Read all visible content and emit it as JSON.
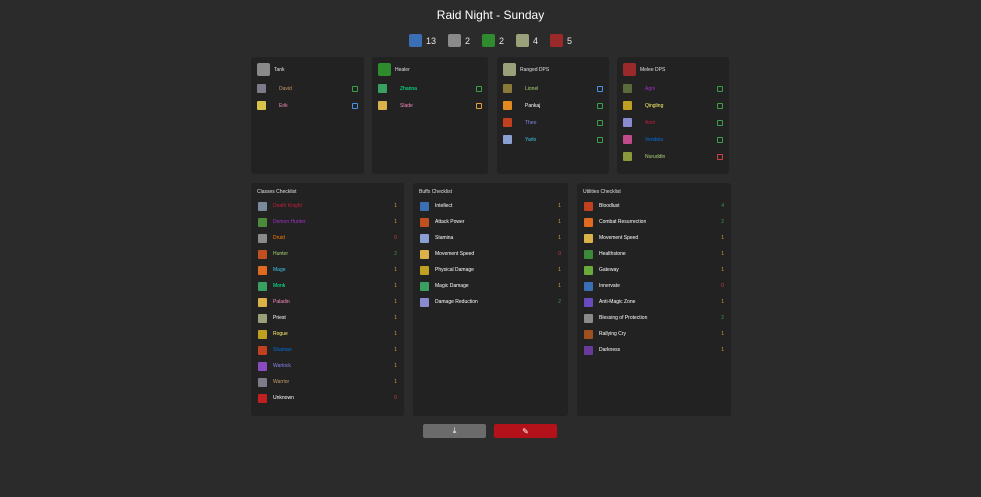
{
  "title": "Raid Night - Sunday",
  "summary": [
    {
      "role": "all",
      "count": "13",
      "icon": "raid-icon",
      "color": "#3a6fb5"
    },
    {
      "role": "tank",
      "count": "2",
      "icon": "shield-icon",
      "color": "#8a8a8a"
    },
    {
      "role": "healer",
      "count": "2",
      "icon": "healer-icon",
      "color": "#2e8b2e"
    },
    {
      "role": "ranged",
      "count": "4",
      "icon": "ranged-icon",
      "color": "#9aa07a"
    },
    {
      "role": "melee",
      "count": "5",
      "icon": "melee-icon",
      "color": "#9a2a2a"
    }
  ],
  "roles": [
    {
      "name": "Tank",
      "icon": "shield-icon",
      "color": "#8a8a8a",
      "players": [
        {
          "name": "David",
          "color": "#c79c6e",
          "icon_color": "#7b7b8a",
          "status": "green"
        },
        {
          "name": "Erik",
          "color": "#f58cba",
          "icon_color": "#d9c24a",
          "status": "blue"
        }
      ]
    },
    {
      "name": "Healer",
      "icon": "healer-icon",
      "color": "#2e8b2e",
      "players": [
        {
          "name": "Zhanna",
          "color": "#00ff98",
          "icon_color": "#3aa060",
          "status": "green"
        },
        {
          "name": "Slade",
          "color": "#f58cba",
          "icon_color": "#d9b34a",
          "status": "orange"
        }
      ]
    },
    {
      "name": "Ranged DPS",
      "icon": "ranged-icon",
      "color": "#9aa07a",
      "players": [
        {
          "name": "Lionel",
          "color": "#abd473",
          "icon_color": "#8a7a3a",
          "status": "blue"
        },
        {
          "name": "Pankaj",
          "color": "#ffffff",
          "icon_color": "#e08a20",
          "status": "green"
        },
        {
          "name": "Theo",
          "color": "#8787ed",
          "icon_color": "#c04020",
          "status": "green"
        },
        {
          "name": "Yarlo",
          "color": "#3fc7eb",
          "icon_color": "#8aa0d0",
          "status": "green"
        }
      ]
    },
    {
      "name": "Melee DPS",
      "icon": "melee-icon",
      "color": "#9a2a2a",
      "players": [
        {
          "name": "Agni",
          "color": "#a330c9",
          "icon_color": "#5a6a3a",
          "status": "green"
        },
        {
          "name": "Qingling",
          "color": "#fff569",
          "icon_color": "#c0a020",
          "status": "green"
        },
        {
          "name": "Amir",
          "color": "#c41f3b",
          "icon_color": "#8a8ad0",
          "status": "green"
        },
        {
          "name": "Vendela",
          "color": "#0070de",
          "icon_color": "#c04a8a",
          "status": "green"
        },
        {
          "name": "Nuruddin",
          "color": "#abd473",
          "icon_color": "#8a9a3a",
          "status": "red"
        }
      ]
    }
  ],
  "checklists": [
    {
      "title": "Classes Checklist",
      "items": [
        {
          "name": "Death Knight",
          "count": "1",
          "color": "#c41f3b",
          "count_color": "#e0a040",
          "icon_color": "#7a8a9a"
        },
        {
          "name": "Demon Hunter",
          "count": "1",
          "color": "#a330c9",
          "count_color": "#e0a040",
          "icon_color": "#4a8a3a"
        },
        {
          "name": "Druid",
          "count": "0",
          "color": "#ff7d0a",
          "count_color": "#d04040",
          "icon_color": "#8a8a8a"
        },
        {
          "name": "Hunter",
          "count": "2",
          "color": "#abd473",
          "count_color": "#3a9d4a",
          "icon_color": "#c05020"
        },
        {
          "name": "Mage",
          "count": "1",
          "color": "#3fc7eb",
          "count_color": "#e0a040",
          "icon_color": "#e06a20"
        },
        {
          "name": "Monk",
          "count": "1",
          "color": "#00ff98",
          "count_color": "#e0a040",
          "icon_color": "#3aa060"
        },
        {
          "name": "Paladin",
          "count": "1",
          "color": "#f58cba",
          "count_color": "#e0a040",
          "icon_color": "#d9b34a"
        },
        {
          "name": "Priest",
          "count": "1",
          "color": "#ffffff",
          "count_color": "#e0a040",
          "icon_color": "#9aa07a"
        },
        {
          "name": "Rogue",
          "count": "1",
          "color": "#fff569",
          "count_color": "#e0a040",
          "icon_color": "#c0a020"
        },
        {
          "name": "Shaman",
          "count": "1",
          "color": "#0070de",
          "count_color": "#e0a040",
          "icon_color": "#c04020"
        },
        {
          "name": "Warlock",
          "count": "1",
          "color": "#8787ed",
          "count_color": "#e0a040",
          "icon_color": "#8a4ac0"
        },
        {
          "name": "Warrior",
          "count": "1",
          "color": "#c79c6e",
          "count_color": "#e0a040",
          "icon_color": "#7b7b8a"
        },
        {
          "name": "Unknown",
          "count": "0",
          "color": "#ffffff",
          "count_color": "#d04040",
          "icon_color": "#c02020"
        }
      ]
    },
    {
      "title": "Buffs Checklist",
      "items": [
        {
          "name": "Intellect",
          "count": "1",
          "color": "#ffffff",
          "count_color": "#e0a040",
          "icon_color": "#3a6fb5"
        },
        {
          "name": "Attack Power",
          "count": "1",
          "color": "#ffffff",
          "count_color": "#e0a040",
          "icon_color": "#c05020"
        },
        {
          "name": "Stamina",
          "count": "1",
          "color": "#ffffff",
          "count_color": "#e0a040",
          "icon_color": "#8aa0d0"
        },
        {
          "name": "Movement Speed",
          "count": "0",
          "color": "#ffffff",
          "count_color": "#d04040",
          "icon_color": "#d9b34a"
        },
        {
          "name": "Physical Damage",
          "count": "1",
          "color": "#ffffff",
          "count_color": "#e0a040",
          "icon_color": "#c0a020"
        },
        {
          "name": "Magic Damage",
          "count": "1",
          "color": "#ffffff",
          "count_color": "#e0a040",
          "icon_color": "#3aa060"
        },
        {
          "name": "Damage Reduction",
          "count": "2",
          "color": "#ffffff",
          "count_color": "#3a9d4a",
          "icon_color": "#8a8ad0"
        }
      ]
    },
    {
      "title": "Utilities Checklist",
      "items": [
        {
          "name": "Bloodlust",
          "count": "4",
          "color": "#ffffff",
          "count_color": "#3a9d4a",
          "icon_color": "#c04020"
        },
        {
          "name": "Combat Resurrection",
          "count": "2",
          "color": "#ffffff",
          "count_color": "#3a9d4a",
          "icon_color": "#e06a20"
        },
        {
          "name": "Movement Speed",
          "count": "1",
          "color": "#ffffff",
          "count_color": "#e0a040",
          "icon_color": "#d9b34a"
        },
        {
          "name": "Healthstone",
          "count": "1",
          "color": "#ffffff",
          "count_color": "#e0a040",
          "icon_color": "#3a8a3a"
        },
        {
          "name": "Gateway",
          "count": "1",
          "color": "#ffffff",
          "count_color": "#e0a040",
          "icon_color": "#6aaa3a"
        },
        {
          "name": "Innervate",
          "count": "0",
          "color": "#ffffff",
          "count_color": "#d04040",
          "icon_color": "#3a6fb5"
        },
        {
          "name": "Anti-Magic Zone",
          "count": "1",
          "color": "#ffffff",
          "count_color": "#e0a040",
          "icon_color": "#6a4ac0"
        },
        {
          "name": "Blessing of Protection",
          "count": "2",
          "color": "#ffffff",
          "count_color": "#3a9d4a",
          "icon_color": "#8a8a8a"
        },
        {
          "name": "Rallying Cry",
          "count": "1",
          "color": "#ffffff",
          "count_color": "#e0a040",
          "icon_color": "#a05020"
        },
        {
          "name": "Darkness",
          "count": "1",
          "color": "#ffffff",
          "count_color": "#e0a040",
          "icon_color": "#6a3a9a"
        }
      ]
    }
  ],
  "buttons": {
    "import_icon": "import-icon",
    "import_color": "#6b6b6b",
    "edit_icon": "pencil-icon",
    "edit_color": "#b3121a"
  }
}
